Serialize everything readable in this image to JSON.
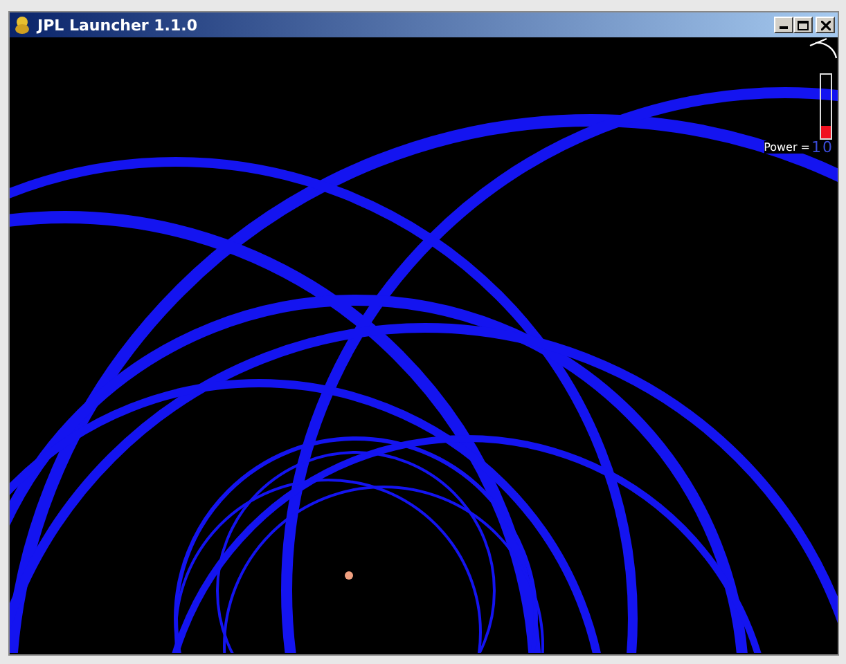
{
  "window": {
    "title": "JPL Launcher 1.1.0"
  },
  "power": {
    "label": "Power =",
    "value": "10",
    "level": 0.2
  }
}
